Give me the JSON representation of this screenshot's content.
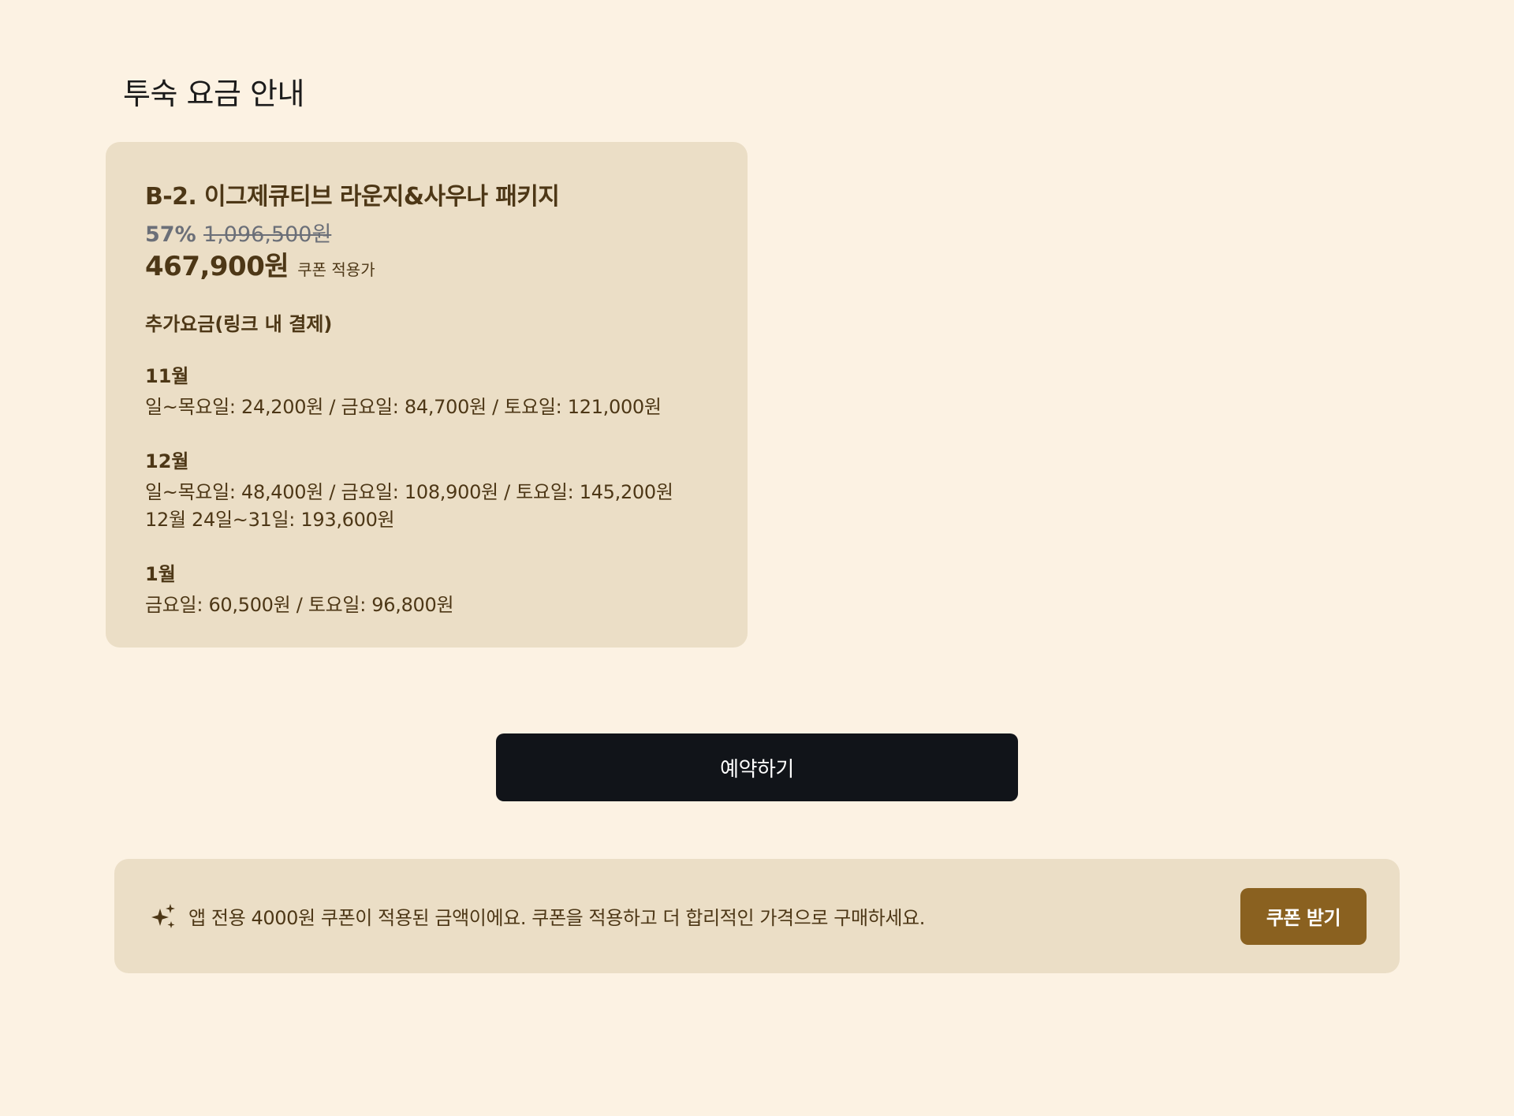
{
  "page": {
    "title": "투숙 요금 안내"
  },
  "card": {
    "package_name": "B-2. 이그제큐티브 라운지&사우나 패키지",
    "discount_percent": "57%",
    "original_price": "1,096,500원",
    "final_price": "467,900원",
    "final_note": "쿠폰 적용가",
    "extra_heading": "추가요금(링크 내 결제)",
    "months": [
      {
        "label": "11월",
        "lines": [
          "일~목요일: 24,200원 / 금요일: 84,700원 / 토요일: 121,000원"
        ]
      },
      {
        "label": "12월",
        "lines": [
          "일~목요일: 48,400원 / 금요일: 108,900원 / 토요일: 145,200원",
          "12월 24일~31일: 193,600원"
        ]
      },
      {
        "label": "1월",
        "lines": [
          "금요일: 60,500원 / 토요일: 96,800원"
        ]
      }
    ]
  },
  "actions": {
    "reserve_label": "예약하기"
  },
  "coupon": {
    "icon": "sparkle-icon",
    "message": "앱 전용 4000원 쿠폰이 적용된 금액이에요. 쿠폰을 적용하고 더 합리적인 가격으로 구매하세요.",
    "button_label": "쿠폰 받기"
  },
  "colors": {
    "background": "#fcf2e3",
    "card": "#ebdec6",
    "text_brown": "#4d3716",
    "muted_gray": "#6b6f78",
    "primary_button": "#111419",
    "coupon_button": "#8a6120"
  }
}
